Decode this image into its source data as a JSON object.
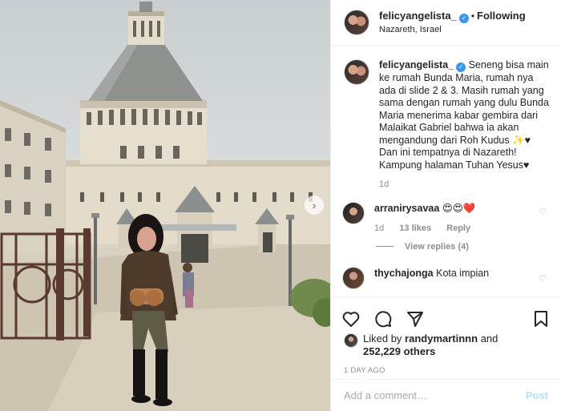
{
  "header": {
    "username": "felicyangelista_",
    "separator": "•",
    "follow_label": "Following",
    "location": "Nazareth, Israel"
  },
  "caption": {
    "username": "felicyangelista_",
    "text": "Seneng bisa main ke rumah Bunda Maria, rumah nya ada di slide 2 & 3. Masih rumah yang sama dengan rumah yang dulu Bunda Maria menerima kabar gembira dari Malaikat Gabriel bahwa ia akan mengandung dari Roh Kudus ✨♥ Dan ini tempatnya di Nazareth! Kampung halaman Tuhan Yesus♥",
    "time": "1d"
  },
  "comments": [
    {
      "username": "arranirysavaa",
      "text": "😍😍❤️",
      "time": "1d",
      "likes": "13 likes",
      "reply_label": "Reply",
      "view_replies": "View replies (4)"
    },
    {
      "username": "thychajonga",
      "text": "Kota impian"
    }
  ],
  "likes": {
    "prefix": "Liked by",
    "user": "randymartinnn",
    "conjunction": "and",
    "count": "252,229 others"
  },
  "date": "1 DAY AGO",
  "add_comment": {
    "placeholder": "Add a comment…",
    "post_label": "Post"
  },
  "colors": {
    "verified": "#3897f0",
    "post_button": "#b2dffc",
    "muted_text": "#8e8e8e"
  },
  "icons": {
    "like": "heart-icon",
    "comment": "comment-icon",
    "share": "share-icon",
    "save": "bookmark-icon",
    "next": "chevron-right-icon"
  }
}
